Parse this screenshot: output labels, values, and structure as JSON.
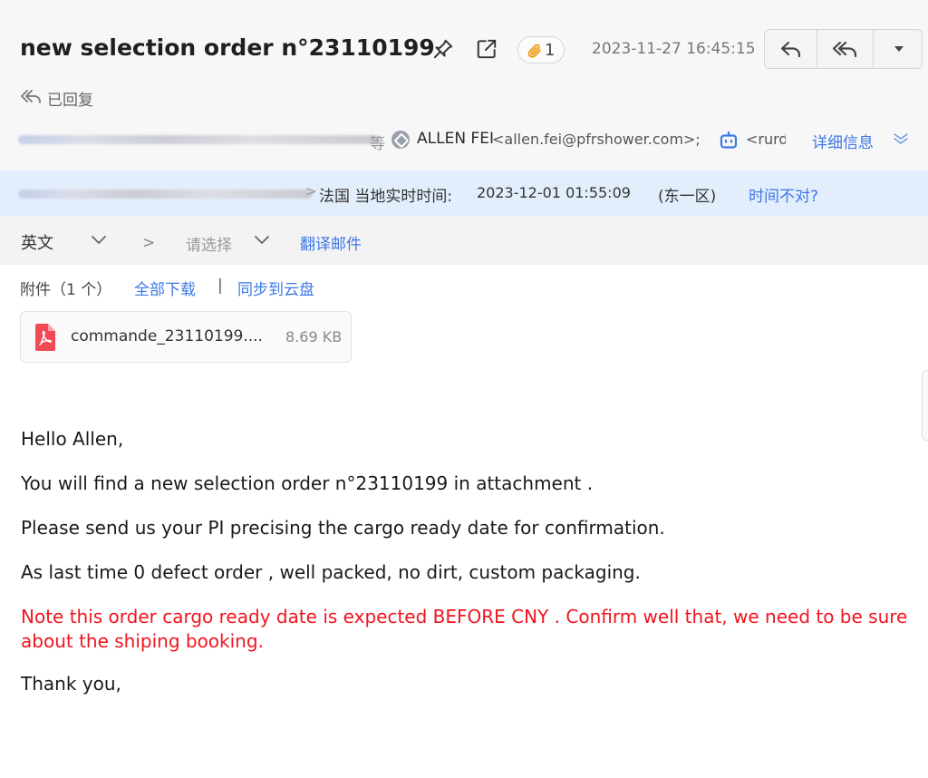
{
  "email": {
    "subject": "new selection order n°23110199",
    "attachment_count": "1",
    "datetime": "2023-11-27 16:45:15",
    "status": "已回复"
  },
  "toolbar": {
    "reply_icon": "reply-icon",
    "reply_all_icon": "reply-all-icon",
    "more_icon": "caret-down-icon"
  },
  "sender": {
    "recipient_tail": "等",
    "name": "ALLEN FEI",
    "email": "<allen.fei@pfrshower.com>;",
    "second_recipient": "<rurd",
    "details_label": "详细信息"
  },
  "timezone": {
    "location_label": "法国 当地实时时间:",
    "local_time": "2023-12-01 01:55:09",
    "zone": "(东一区)",
    "wrong_time_link": "时间不对?"
  },
  "translation": {
    "source_lang": "英文",
    "arrow": ">",
    "target_placeholder": "请选择",
    "translate_button": "翻译邮件"
  },
  "attachments": {
    "label": "附件（1 个）",
    "download_all": "全部下载",
    "separator": "|",
    "sync_cloud": "同步到云盘",
    "files": [
      {
        "name": "commande_23110199....",
        "size": "8.69 KB",
        "icon": "pdf-icon"
      }
    ]
  },
  "body": {
    "greeting": "Hello Allen,",
    "line1": "You will find a new selection order n°23110199  in attachment .",
    "line2": "Please send us your PI precising the cargo ready date for confirmation.",
    "line3": "As last time 0 defect order , well packed, no dirt, custom packaging.",
    "note": "Note this order cargo ready date is expected BEFORE CNY . Confirm well that, we need to be sure about the shiping booking.",
    "closing": "Thank you,"
  },
  "colors": {
    "link": "#3c78e6",
    "note_red": "#f0141e",
    "tz_bar": "#e3eefc",
    "header_bg": "#f7f7f7",
    "attachment_badge": "#f0a020",
    "pdf_red": "#f04b55"
  }
}
